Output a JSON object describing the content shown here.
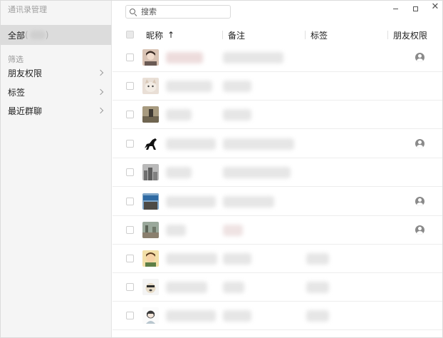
{
  "app_title": "通讯录管理",
  "sidebar": {
    "all_label": "全部",
    "filter_label": "筛选",
    "items": [
      {
        "label": "朋友权限"
      },
      {
        "label": "标签"
      },
      {
        "label": "最近群聊"
      }
    ]
  },
  "search": {
    "placeholder": "搜索"
  },
  "table": {
    "headers": [
      "昵称",
      "备注",
      "标签",
      "朋友权限"
    ],
    "sort_indicator": "↑",
    "rows": [
      {
        "avatar_icon": "avatar-girl-icon",
        "has_tag": false,
        "restricted": true
      },
      {
        "avatar_icon": "avatar-cat-icon",
        "has_tag": false,
        "restricted": false
      },
      {
        "avatar_icon": "avatar-photo-icon",
        "has_tag": false,
        "restricted": false
      },
      {
        "avatar_icon": "avatar-horse-icon",
        "has_tag": false,
        "restricted": true
      },
      {
        "avatar_icon": "avatar-city-icon",
        "has_tag": false,
        "restricted": false
      },
      {
        "avatar_icon": "avatar-sign-icon",
        "has_tag": false,
        "restricted": true
      },
      {
        "avatar_icon": "avatar-street-icon",
        "has_tag": false,
        "restricted": true
      },
      {
        "avatar_icon": "avatar-cartoon-icon",
        "has_tag": true,
        "restricted": false
      },
      {
        "avatar_icon": "avatar-dog-icon",
        "has_tag": true,
        "restricted": false
      },
      {
        "avatar_icon": "avatar-sketch-icon",
        "has_tag": true,
        "restricted": false
      }
    ]
  },
  "colors": {
    "sidebar_bg": "#f5f5f5",
    "selected_bg": "#dcdcdc",
    "permission_icon": "#8a8a8a"
  }
}
